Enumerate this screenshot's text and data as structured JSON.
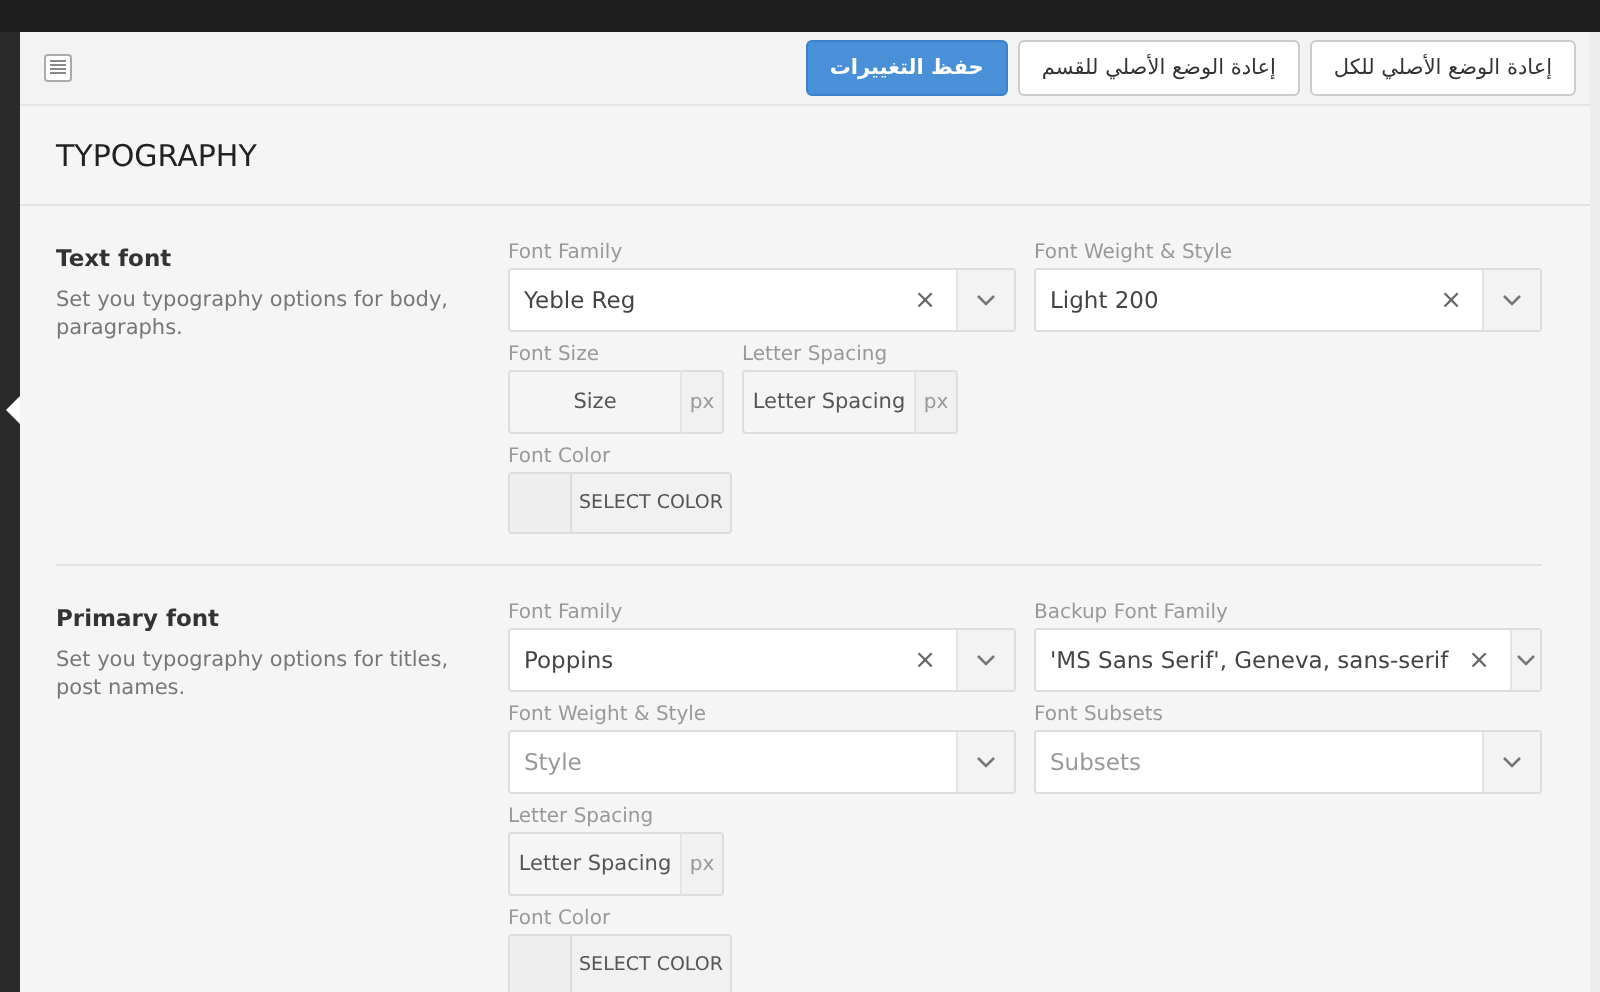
{
  "toolbar": {
    "buttons": [
      {
        "kind": "default",
        "label": "إعادة الوضع الأصلي للكل"
      },
      {
        "kind": "default",
        "label": "إعادة الوضع الأصلي للقسم"
      },
      {
        "kind": "primary",
        "label": "حفظ التغييرات"
      }
    ]
  },
  "panel": {
    "title": "TYPOGRAPHY"
  },
  "sections": [
    {
      "title": "Text font",
      "description": "Set you typography options for body, paragraphs.",
      "rows": [
        [
          {
            "kind": "select",
            "label": "Font Family",
            "value": "Yeble Reg",
            "clear": "×"
          },
          {
            "kind": "select",
            "label": "Font Weight & Style",
            "value": "Light 200",
            "clear": "×"
          }
        ],
        [
          {
            "kind": "number",
            "label": "Font Size",
            "placeholder": "Size",
            "unit": "px"
          },
          {
            "kind": "number",
            "label": "Letter Spacing",
            "placeholder": "Letter Spacing",
            "unit": "px"
          }
        ],
        [
          {
            "kind": "color",
            "label": "Font Color",
            "button": "SELECT COLOR"
          }
        ]
      ]
    },
    {
      "title": "Primary font",
      "description": "Set you typography options for titles, post names.",
      "rows": [
        [
          {
            "kind": "select",
            "label": "Font Family",
            "value": "Poppins",
            "clear": "×"
          },
          {
            "kind": "select",
            "label": "Backup Font Family",
            "value": "'MS Sans Serif', Geneva, sans-serif",
            "clear": "×"
          }
        ],
        [
          {
            "kind": "select",
            "label": "Font Weight & Style",
            "placeholder": "Style"
          },
          {
            "kind": "select",
            "label": "Font Subsets",
            "placeholder": "Subsets"
          }
        ],
        [
          {
            "kind": "number",
            "label": "Letter Spacing",
            "placeholder": "Letter Spacing",
            "unit": "px"
          }
        ],
        [
          {
            "kind": "color",
            "label": "Font Color",
            "button": "SELECT COLOR"
          }
        ]
      ]
    }
  ]
}
